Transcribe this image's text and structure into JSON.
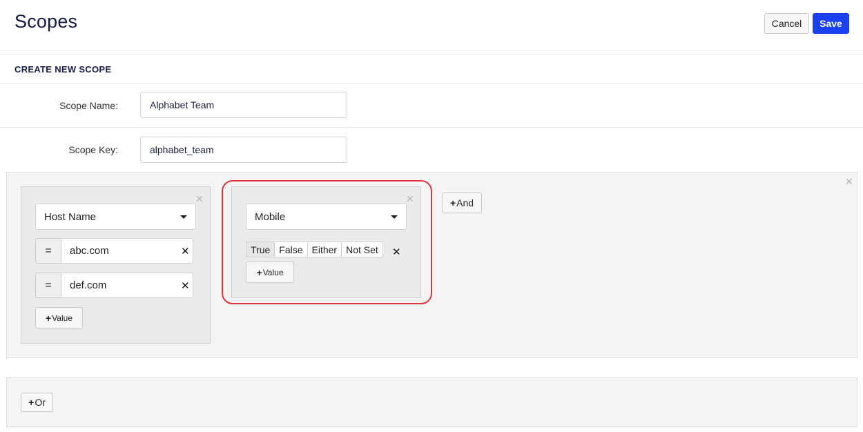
{
  "header": {
    "title": "Scopes",
    "cancel_label": "Cancel",
    "save_label": "Save"
  },
  "section": {
    "title": "CREATE NEW SCOPE"
  },
  "form": {
    "scope_name": {
      "label": "Scope Name:",
      "value": "Alphabet Team"
    },
    "scope_key": {
      "label": "Scope Key:",
      "value": "alphabet_team"
    }
  },
  "conditions": {
    "host": {
      "field": "Host Name",
      "rows": [
        {
          "operator": "=",
          "value": "abc.com"
        },
        {
          "operator": "=",
          "value": "def.com"
        }
      ],
      "add_value_label": "Value"
    },
    "mobile": {
      "field": "Mobile",
      "options": [
        "True",
        "False",
        "Either",
        "Not Set"
      ],
      "selected": "True",
      "add_value_label": "Value"
    },
    "and_label": "And",
    "or_label": "Or"
  },
  "icons": {
    "close": "close-icon",
    "remove": "remove-icon",
    "dropdown": "chevron-down-icon",
    "plus": "plus-icon"
  },
  "colors": {
    "accent": "#1a40f0",
    "highlight": "#e0333b"
  }
}
